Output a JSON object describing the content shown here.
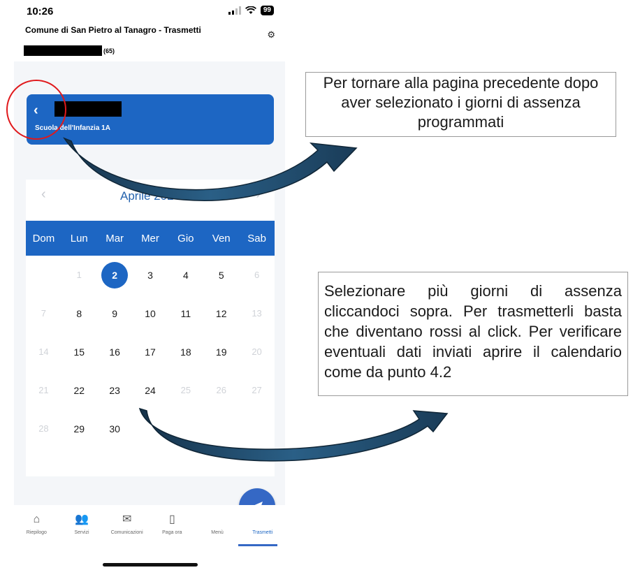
{
  "status_bar": {
    "time": "10:26",
    "battery": "99"
  },
  "header": {
    "app_title": "Comune di San Pietro al Tanagro - Trasmetti",
    "user_suffix": "(65)"
  },
  "class_card": {
    "back_label": "‹",
    "class_name": "Scuola dell'Infanzia 1A"
  },
  "calendar": {
    "month_label": "Aprile 2024",
    "prev_label": "‹",
    "next_label": "›",
    "weekdays": [
      "Dom",
      "Lun",
      "Mar",
      "Mer",
      "Gio",
      "Ven",
      "Sab"
    ],
    "days": [
      {
        "label": "",
        "state": "empty"
      },
      {
        "label": "1",
        "state": "muted"
      },
      {
        "label": "2",
        "state": "selected"
      },
      {
        "label": "3",
        "state": "normal"
      },
      {
        "label": "4",
        "state": "normal"
      },
      {
        "label": "5",
        "state": "normal"
      },
      {
        "label": "6",
        "state": "muted"
      },
      {
        "label": "7",
        "state": "muted"
      },
      {
        "label": "8",
        "state": "normal"
      },
      {
        "label": "9",
        "state": "normal"
      },
      {
        "label": "10",
        "state": "normal"
      },
      {
        "label": "11",
        "state": "normal"
      },
      {
        "label": "12",
        "state": "normal"
      },
      {
        "label": "13",
        "state": "muted"
      },
      {
        "label": "14",
        "state": "muted"
      },
      {
        "label": "15",
        "state": "normal"
      },
      {
        "label": "16",
        "state": "normal"
      },
      {
        "label": "17",
        "state": "normal"
      },
      {
        "label": "18",
        "state": "normal"
      },
      {
        "label": "19",
        "state": "normal"
      },
      {
        "label": "20",
        "state": "muted"
      },
      {
        "label": "21",
        "state": "muted"
      },
      {
        "label": "22",
        "state": "normal"
      },
      {
        "label": "23",
        "state": "normal"
      },
      {
        "label": "24",
        "state": "normal"
      },
      {
        "label": "25",
        "state": "muted"
      },
      {
        "label": "26",
        "state": "muted"
      },
      {
        "label": "27",
        "state": "muted"
      },
      {
        "label": "28",
        "state": "muted"
      },
      {
        "label": "29",
        "state": "normal"
      },
      {
        "label": "30",
        "state": "normal"
      }
    ]
  },
  "tab_bar": {
    "tabs": [
      {
        "label": "Riepilogo",
        "icon": "home-icon"
      },
      {
        "label": "Servizi",
        "icon": "users-icon"
      },
      {
        "label": "Comunicazioni",
        "icon": "envelope-icon"
      },
      {
        "label": "Paga ora",
        "icon": "card-icon"
      },
      {
        "label": "Menù",
        "icon": "menu-icon"
      },
      {
        "label": "Trasmetti",
        "icon": "send-icon",
        "active": true
      }
    ]
  },
  "annotations": {
    "note_top": "Per tornare alla pagina precedente dopo aver selezionato i giorni di assenza programmati",
    "note_bottom": "Selezionare più giorni di assenza cliccandoci sopra. Per trasmetterli basta che diventano rossi al click. Per verificare eventuali dati inviati aprire il calendario come da punto 4.2"
  },
  "colors": {
    "primary": "#1d66c3",
    "fab": "#3568c5",
    "annotation_circle": "#e0191c",
    "arrow": "#1f4e6e"
  }
}
